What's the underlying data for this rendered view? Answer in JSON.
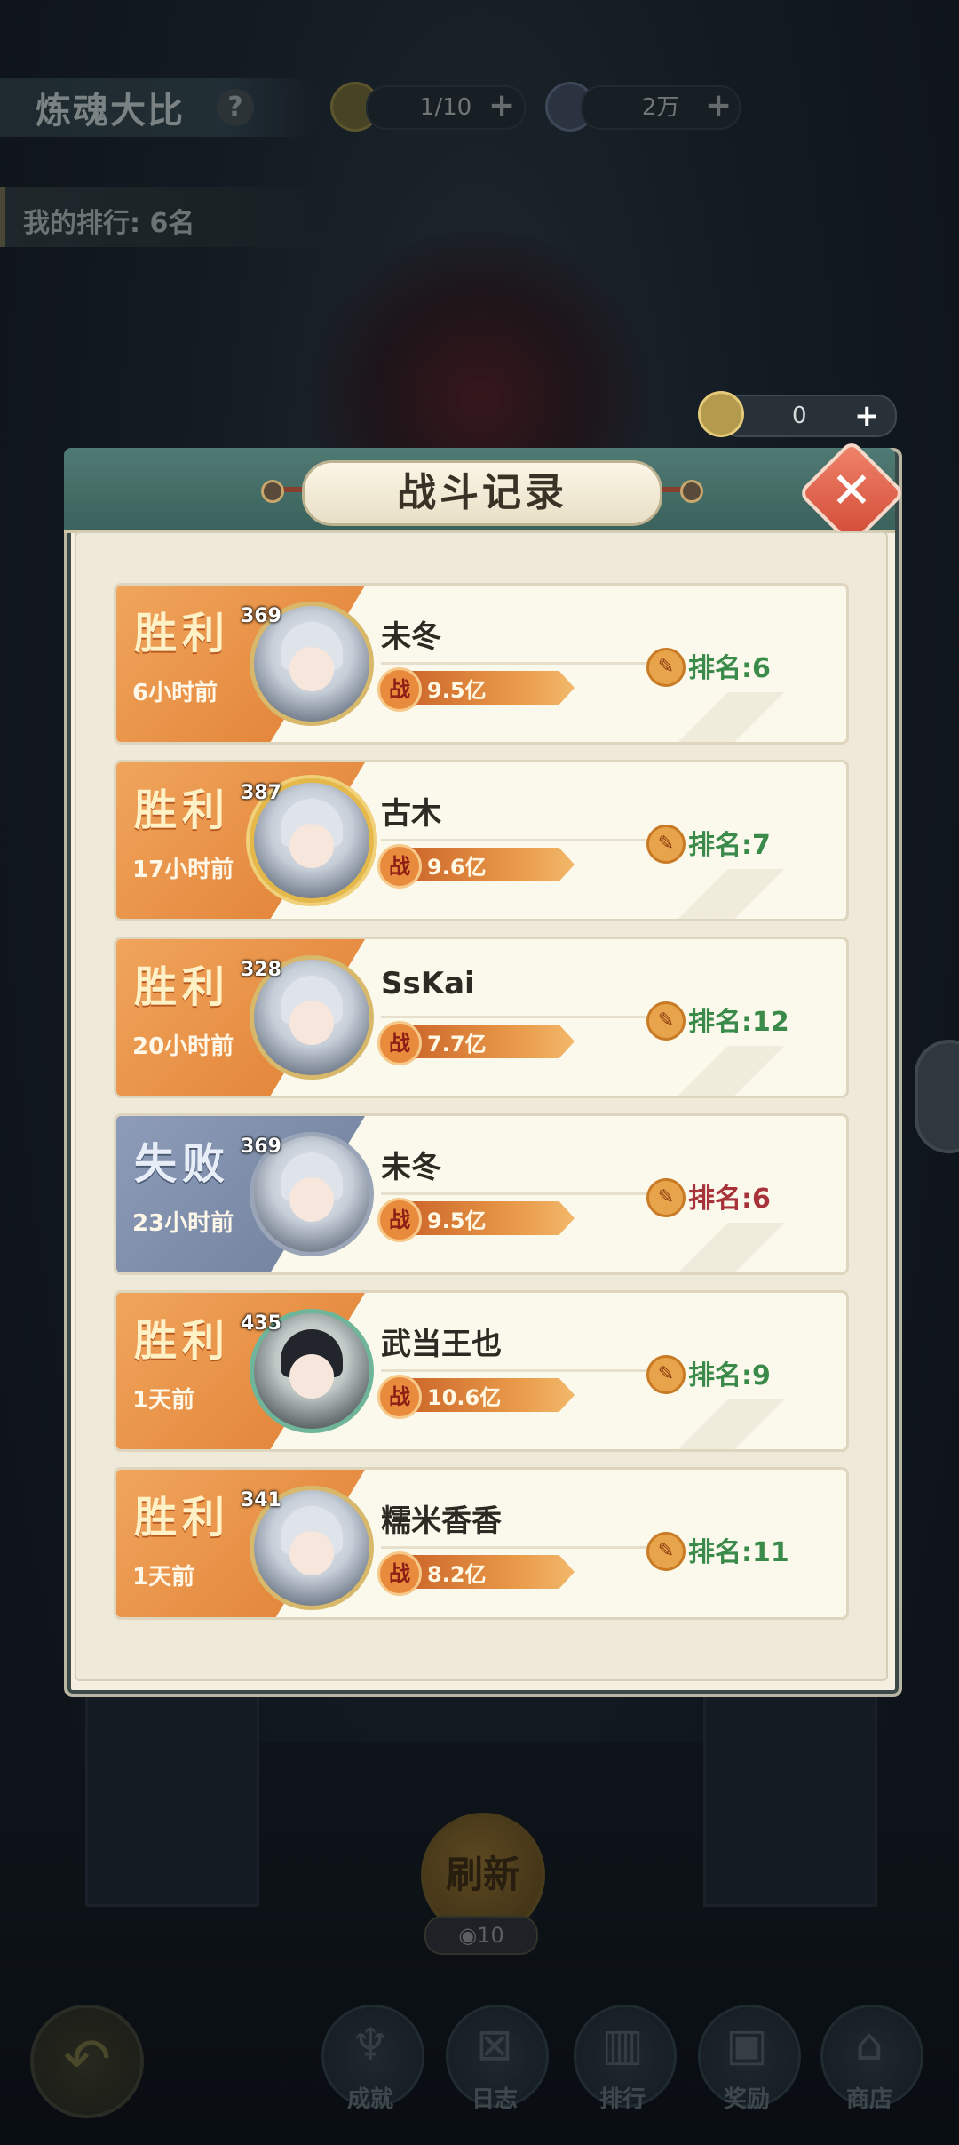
{
  "top_bar": {
    "title": "炼魂大比",
    "help_icon": "question-mark-icon",
    "tickets": "1/10",
    "currency": "2万",
    "my_rank": "我的排行: 6名",
    "ticket_count": "0"
  },
  "dialog": {
    "title": "战斗记录",
    "close_icon": "close-x-icon"
  },
  "records": [
    {
      "result": "胜利",
      "time": "6小时前",
      "level": "369",
      "name": "未冬",
      "power_badge": "战",
      "power": "9.5亿",
      "rank": "排名:6",
      "outcome": "win"
    },
    {
      "result": "胜利",
      "time": "17小时前",
      "level": "387",
      "name": "古木",
      "power_badge": "战",
      "power": "9.6亿",
      "rank": "排名:7",
      "outcome": "win"
    },
    {
      "result": "胜利",
      "time": "20小时前",
      "level": "328",
      "name": "SsKai",
      "power_badge": "战",
      "power": "7.7亿",
      "rank": "排名:12",
      "outcome": "win"
    },
    {
      "result": "失败",
      "time": "23小时前",
      "level": "369",
      "name": "未冬",
      "power_badge": "战",
      "power": "9.5亿",
      "rank": "排名:6",
      "outcome": "loss"
    },
    {
      "result": "胜利",
      "time": "1天前",
      "level": "435",
      "name": "武当王也",
      "power_badge": "战",
      "power": "10.6亿",
      "rank": "排名:9",
      "outcome": "win"
    },
    {
      "result": "胜利",
      "time": "1天前",
      "level": "341",
      "name": "糯米香香",
      "power_badge": "战",
      "power": "8.2亿",
      "rank": "排名:11",
      "outcome": "win"
    }
  ],
  "bottom": {
    "refresh_label": "刷新",
    "refresh_cost": "10",
    "nav": [
      {
        "label": "成就",
        "icon": "achievement-icon"
      },
      {
        "label": "日志",
        "icon": "log-icon"
      },
      {
        "label": "排行",
        "icon": "ranking-icon"
      },
      {
        "label": "奖励",
        "icon": "reward-icon"
      },
      {
        "label": "商店",
        "icon": "shop-icon"
      }
    ]
  },
  "colors": {
    "win": "#e07f33",
    "loss": "#6f7f9c",
    "rank_win": "#3a8a4a",
    "rank_loss": "#a8323a",
    "header": "#3b625c"
  }
}
